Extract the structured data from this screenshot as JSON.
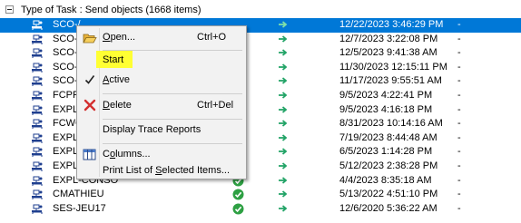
{
  "group": {
    "title": "Type of Task : Send objects (1668 items)"
  },
  "rows": [
    {
      "name": "SCO-/",
      "date": "12/22/2023 3:46:29 PM",
      "dash": "-",
      "selected": true,
      "status": "none"
    },
    {
      "name": "SCO-\\",
      "date": "12/7/2023 3:22:08 PM",
      "dash": "-",
      "selected": false,
      "status": "none"
    },
    {
      "name": "SCO-C",
      "date": "12/5/2023 9:41:38 AM",
      "dash": "-",
      "selected": false,
      "status": "none"
    },
    {
      "name": "SCO-C",
      "date": "11/30/2023 12:15:11 PM",
      "dash": "-",
      "selected": false,
      "status": "none"
    },
    {
      "name": "SCO-C",
      "date": "11/17/2023 9:55:51 AM",
      "dash": "-",
      "selected": false,
      "status": "none"
    },
    {
      "name": "FCPR",
      "date": "9/5/2023 4:22:41 PM",
      "dash": "-",
      "selected": false,
      "status": "none"
    },
    {
      "name": "EXPL",
      "date": "9/5/2023 4:16:18 PM",
      "dash": "-",
      "selected": false,
      "status": "none"
    },
    {
      "name": "FCWC",
      "date": "8/31/2023 10:14:16 AM",
      "dash": "-",
      "selected": false,
      "status": "none"
    },
    {
      "name": "EXPL",
      "date": "7/19/2023 8:44:48 AM",
      "dash": "-",
      "selected": false,
      "status": "none"
    },
    {
      "name": "EXPL",
      "date": "6/5/2023 1:14:28 PM",
      "dash": "-",
      "selected": false,
      "status": "none"
    },
    {
      "name": "EXPL",
      "date": "5/12/2023 2:38:28 PM",
      "dash": "-",
      "selected": false,
      "status": "none"
    },
    {
      "name": "EXPL-CONSO",
      "date": "4/4/2023 8:35:18 AM",
      "dash": "-",
      "selected": false,
      "status": "ok"
    },
    {
      "name": "CMATHIEU",
      "date": "5/13/2022 4:51:10 PM",
      "dash": "-",
      "selected": false,
      "status": "ok"
    },
    {
      "name": "SES-JEU17",
      "date": "12/6/2020 5:36:22 AM",
      "dash": "-",
      "selected": false,
      "status": "ok"
    }
  ],
  "context_menu": {
    "open": {
      "label_u": "O",
      "label_rest": "pen...",
      "shortcut": "Ctrl+O"
    },
    "start": {
      "label": "Start"
    },
    "active": {
      "label_u": "A",
      "label_rest": "ctive",
      "checked": true
    },
    "delete": {
      "label_u": "D",
      "label_rest": "elete",
      "shortcut": "Ctrl+Del"
    },
    "trace": {
      "label": "Display Trace Reports"
    },
    "columns": {
      "label_pre": "C",
      "label_u": "o",
      "label_rest": "lumns..."
    },
    "print": {
      "label_pre": "Print List of ",
      "label_u": "S",
      "label_rest": "elected Items..."
    }
  },
  "colors": {
    "selection": "#0078d7",
    "highlight": "#ffff33",
    "arrow_green": "#21a366",
    "ok_green": "#2ea043",
    "delete_red": "#d32f2f"
  }
}
